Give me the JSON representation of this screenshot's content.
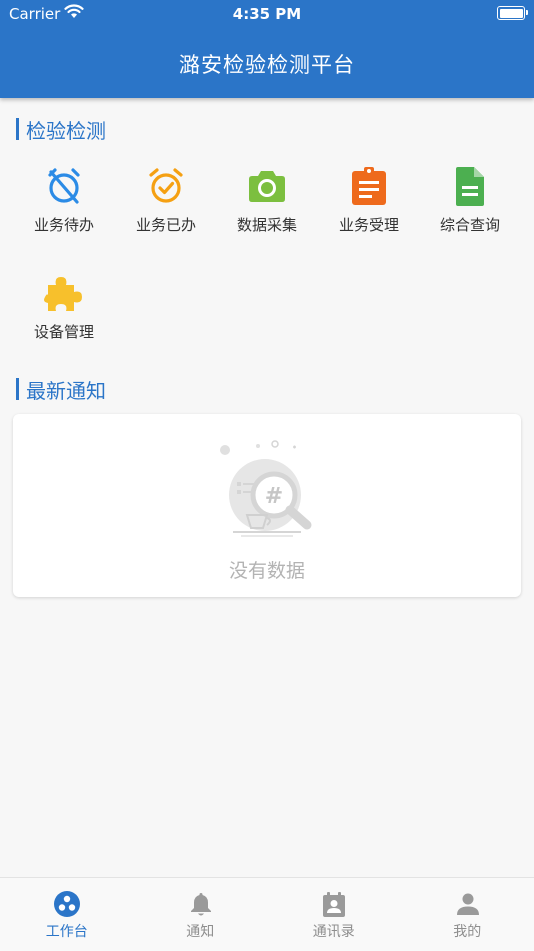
{
  "status_bar": {
    "carrier": "Carrier",
    "time": "4:35 PM"
  },
  "header": {
    "title": "潞安检验检测平台"
  },
  "sections": {
    "inspection": {
      "title": "检验检测"
    },
    "notices": {
      "title": "最新通知"
    }
  },
  "grid_items": [
    {
      "label": "业务待办",
      "icon": "alarm-off-icon",
      "color": "#2b8be6"
    },
    {
      "label": "业务已办",
      "icon": "alarm-check-icon",
      "color": "#f5a012"
    },
    {
      "label": "数据采集",
      "icon": "camera-icon",
      "color": "#7cbf3f"
    },
    {
      "label": "业务受理",
      "icon": "clipboard-icon",
      "color": "#ee6a1c"
    },
    {
      "label": "综合查询",
      "icon": "document-icon",
      "color": "#4caf50"
    },
    {
      "label": "设备管理",
      "icon": "puzzle-icon",
      "color": "#f7c02c"
    }
  ],
  "empty_state": {
    "text": "没有数据"
  },
  "tabbar": {
    "active_color": "#2b75c8",
    "items": [
      {
        "label": "工作台",
        "icon": "workbench-icon",
        "active": true
      },
      {
        "label": "通知",
        "icon": "bell-icon",
        "active": false
      },
      {
        "label": "通讯录",
        "icon": "contacts-icon",
        "active": false
      },
      {
        "label": "我的",
        "icon": "person-icon",
        "active": false
      }
    ]
  }
}
